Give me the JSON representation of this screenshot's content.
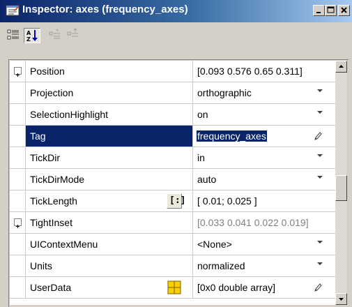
{
  "window": {
    "title": "Inspector: axes (frequency_axes)"
  },
  "toolbar": {
    "buttons": [
      {
        "icon": "categorized-icon",
        "pressed": false
      },
      {
        "icon": "sort-alphabetical-icon",
        "pressed": true
      },
      {
        "icon": "expand-all-icon",
        "pressed": false
      },
      {
        "icon": "collapse-all-icon",
        "pressed": false
      }
    ]
  },
  "properties": [
    {
      "name": "Position",
      "value": "[0.093 0.576 0.65 0.311]",
      "expandable": true,
      "control": "none"
    },
    {
      "name": "Projection",
      "value": "orthographic",
      "control": "dropdown"
    },
    {
      "name": "SelectionHighlight",
      "value": "on",
      "control": "dropdown"
    },
    {
      "name": "Tag",
      "value": "frequency_axes",
      "control": "edit",
      "selected": true
    },
    {
      "name": "TickDir",
      "value": "in",
      "control": "dropdown"
    },
    {
      "name": "TickDirMode",
      "value": "auto",
      "control": "dropdown"
    },
    {
      "name": "TickLength",
      "value": "[ 0.01; 0.025 ]",
      "control": "none",
      "side_button": "[:]"
    },
    {
      "name": "TightInset",
      "value": "[0.033 0.041 0.022 0.019]",
      "expandable": true,
      "control": "none",
      "readonly": true
    },
    {
      "name": "UIContextMenu",
      "value": "<None>",
      "control": "dropdown"
    },
    {
      "name": "Units",
      "value": "normalized",
      "control": "dropdown"
    },
    {
      "name": "UserData",
      "value": "[0x0  double array]",
      "control": "edit",
      "side_icon": "grid-icon"
    }
  ],
  "colors": {
    "selection": "#0a246a",
    "title_start": "#0a246a",
    "title_end": "#a6caf0"
  }
}
